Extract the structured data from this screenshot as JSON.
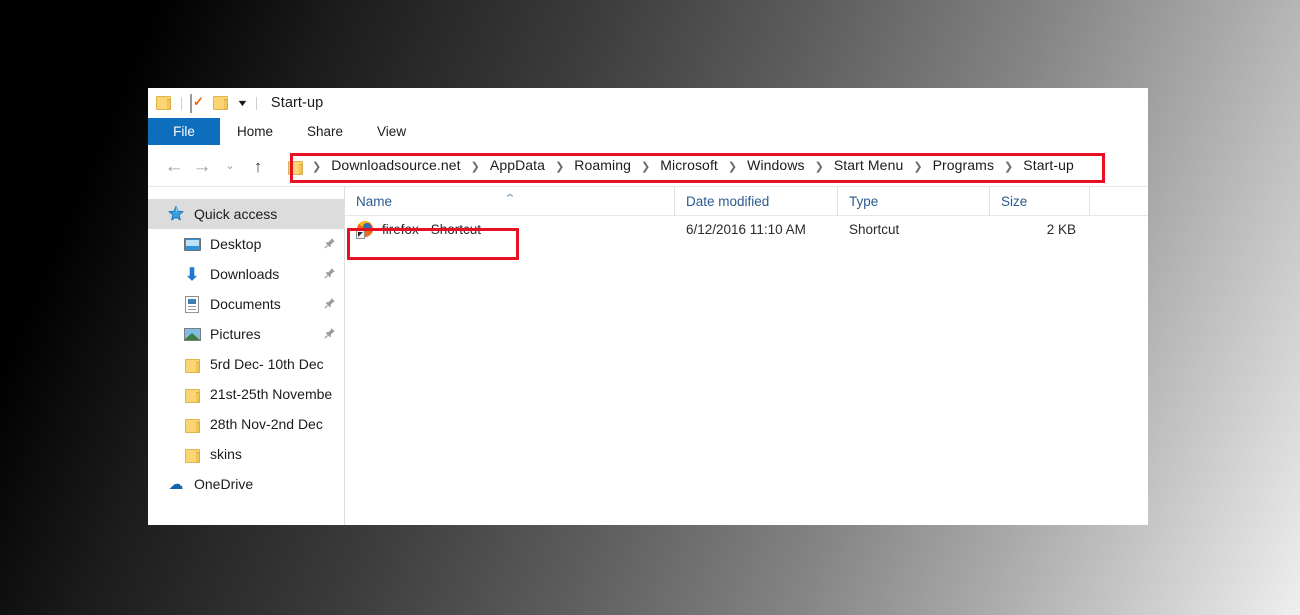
{
  "window": {
    "title": "Start-up",
    "quick_access_toolbar": [
      {
        "name": "folder-icon",
        "label": "Properties menu folder"
      },
      {
        "name": "properties-icon",
        "label": "Properties"
      },
      {
        "name": "new-folder-icon",
        "label": "New folder"
      },
      {
        "name": "customize-caret-icon",
        "label": "Customize Quick Access Toolbar"
      }
    ]
  },
  "ribbon": {
    "tabs": [
      {
        "id": "file",
        "label": "File",
        "active": true
      },
      {
        "id": "home",
        "label": "Home",
        "active": false
      },
      {
        "id": "share",
        "label": "Share",
        "active": false
      },
      {
        "id": "view",
        "label": "View",
        "active": false
      }
    ]
  },
  "navbar": {
    "back_icon": "←",
    "forward_icon": "→",
    "recent_icon": "⌄",
    "up_icon": "↑",
    "breadcrumb_separator": "❯",
    "breadcrumbs": [
      "Downloadsource.net",
      "AppData",
      "Roaming",
      "Microsoft",
      "Windows",
      "Start Menu",
      "Programs",
      "Start-up"
    ]
  },
  "navpane": {
    "items": [
      {
        "label": "Quick access",
        "icon": "star-icon",
        "selected": true,
        "pinned": false,
        "indent": 0
      },
      {
        "label": "Desktop",
        "icon": "desktop-icon",
        "selected": false,
        "pinned": true,
        "indent": 1
      },
      {
        "label": "Downloads",
        "icon": "download-icon",
        "selected": false,
        "pinned": true,
        "indent": 1
      },
      {
        "label": "Documents",
        "icon": "document-icon",
        "selected": false,
        "pinned": true,
        "indent": 1
      },
      {
        "label": "Pictures",
        "icon": "picture-icon",
        "selected": false,
        "pinned": true,
        "indent": 1
      },
      {
        "label": "5rd Dec- 10th Dec",
        "icon": "folder-icon",
        "selected": false,
        "pinned": false,
        "indent": 1
      },
      {
        "label": "21st-25th Novembe",
        "icon": "folder-icon",
        "selected": false,
        "pinned": false,
        "indent": 1
      },
      {
        "label": "28th Nov-2nd Dec",
        "icon": "folder-icon",
        "selected": false,
        "pinned": false,
        "indent": 1
      },
      {
        "label": "skins",
        "icon": "folder-icon",
        "selected": false,
        "pinned": false,
        "indent": 1
      },
      {
        "label": "OneDrive",
        "icon": "onedrive-icon",
        "selected": false,
        "pinned": false,
        "indent": 0
      }
    ],
    "pin_glyph": "📌"
  },
  "filelist": {
    "columns": [
      {
        "key": "name",
        "label": "Name",
        "sorted": true,
        "sort_glyph": "⌃"
      },
      {
        "key": "date",
        "label": "Date modified",
        "sorted": false,
        "sort_glyph": ""
      },
      {
        "key": "type",
        "label": "Type",
        "sorted": false,
        "sort_glyph": ""
      },
      {
        "key": "size",
        "label": "Size",
        "sorted": false,
        "sort_glyph": ""
      }
    ],
    "rows": [
      {
        "icon": "firefox-shortcut-icon",
        "name": "firefox - Shortcut",
        "date": "6/12/2016 11:10 AM",
        "type": "Shortcut",
        "size": "2 KB",
        "highlighted": true
      }
    ]
  },
  "annotations": {
    "highlight_color": "#e81123",
    "boxes": [
      {
        "name": "address-bar-highlight",
        "target": "breadcrumb"
      },
      {
        "name": "file-row-highlight",
        "target": "firefox - Shortcut"
      }
    ]
  },
  "colors": {
    "file_tab_blue": "#0c6ebd",
    "column_header_text": "#2a5a90",
    "selection_gray": "#dcdcdc",
    "folder_yellow": "#fbd474"
  }
}
